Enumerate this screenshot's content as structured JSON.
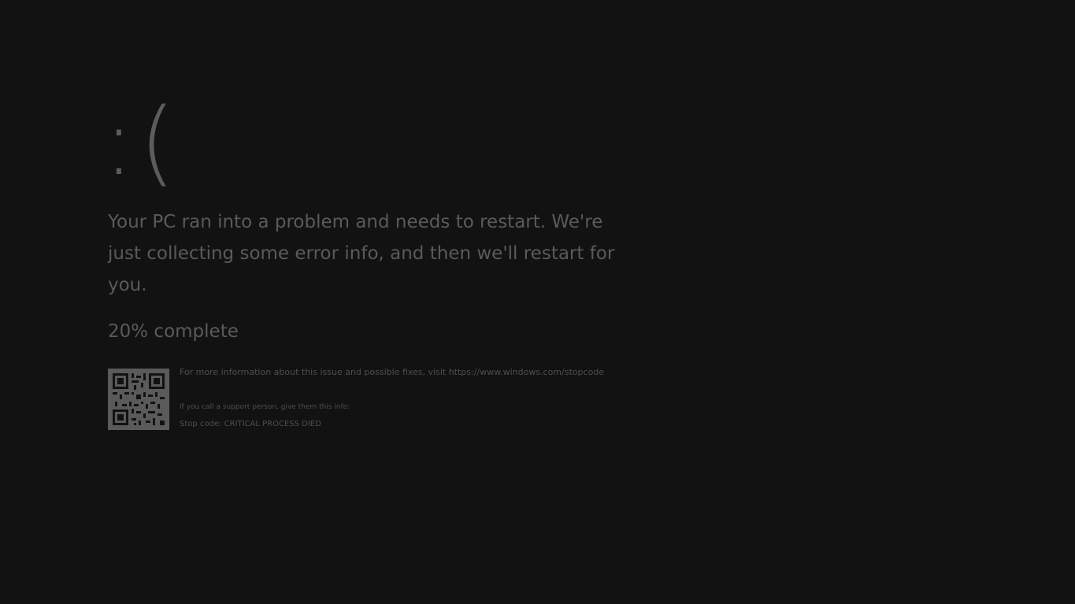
{
  "screen": {
    "background_color": "#121212",
    "text_color": "#5a5a5a"
  },
  "error": {
    "emoticon": ":(",
    "message": "Your PC ran into a problem and needs to restart. We're just collecting some error info, and then we'll restart for you.",
    "progress_percent": 20,
    "progress_text": "20% complete"
  },
  "details": {
    "qr_code_icon": "qr-code",
    "more_info": "For more information about this issue and possible fixes, visit https://www.windows.com/stopcode",
    "support_hint": "If you call a support person, give them this info:",
    "stop_code": "Stop code: CRITICAL PROCESS DIED"
  }
}
